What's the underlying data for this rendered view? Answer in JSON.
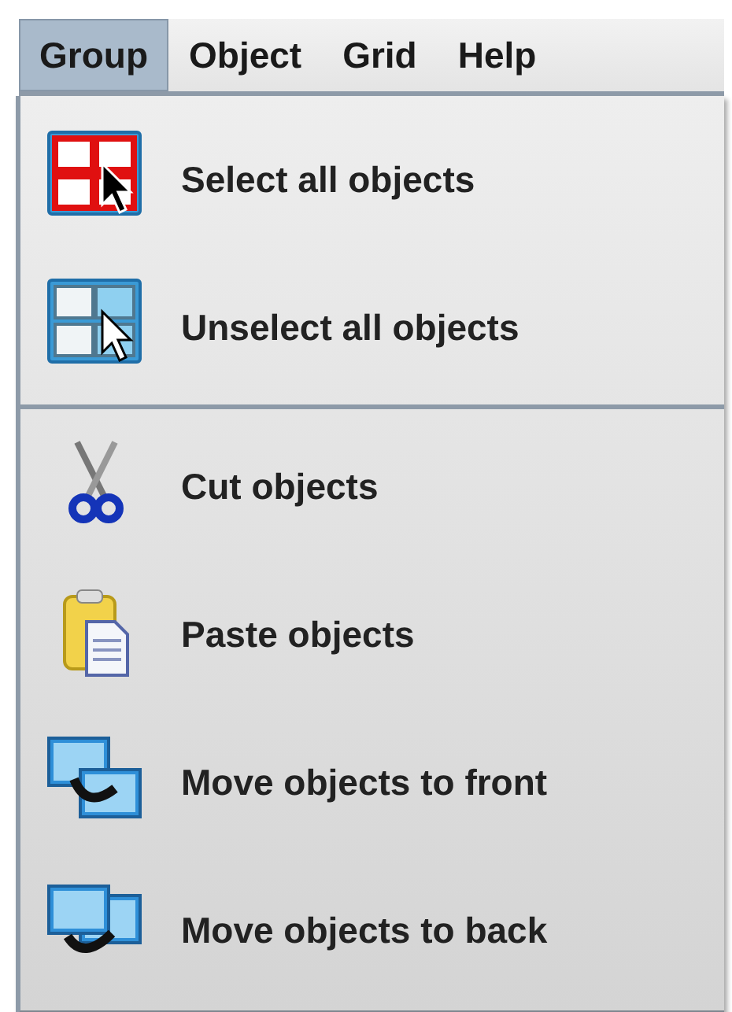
{
  "menubar": [
    {
      "label": "Group",
      "selected": true
    },
    {
      "label": "Object",
      "selected": false
    },
    {
      "label": "Grid",
      "selected": false
    },
    {
      "label": "Help",
      "selected": false
    }
  ],
  "menu": {
    "sections": [
      [
        {
          "kind": "select-all",
          "label": "Select all objects"
        },
        {
          "kind": "unselect-all",
          "label": "Unselect all objects"
        }
      ],
      [
        {
          "kind": "cut",
          "label": "Cut objects"
        },
        {
          "kind": "paste",
          "label": "Paste objects"
        },
        {
          "kind": "to-front",
          "label": "Move objects to front"
        },
        {
          "kind": "to-back",
          "label": "Move objects to back"
        }
      ]
    ]
  }
}
